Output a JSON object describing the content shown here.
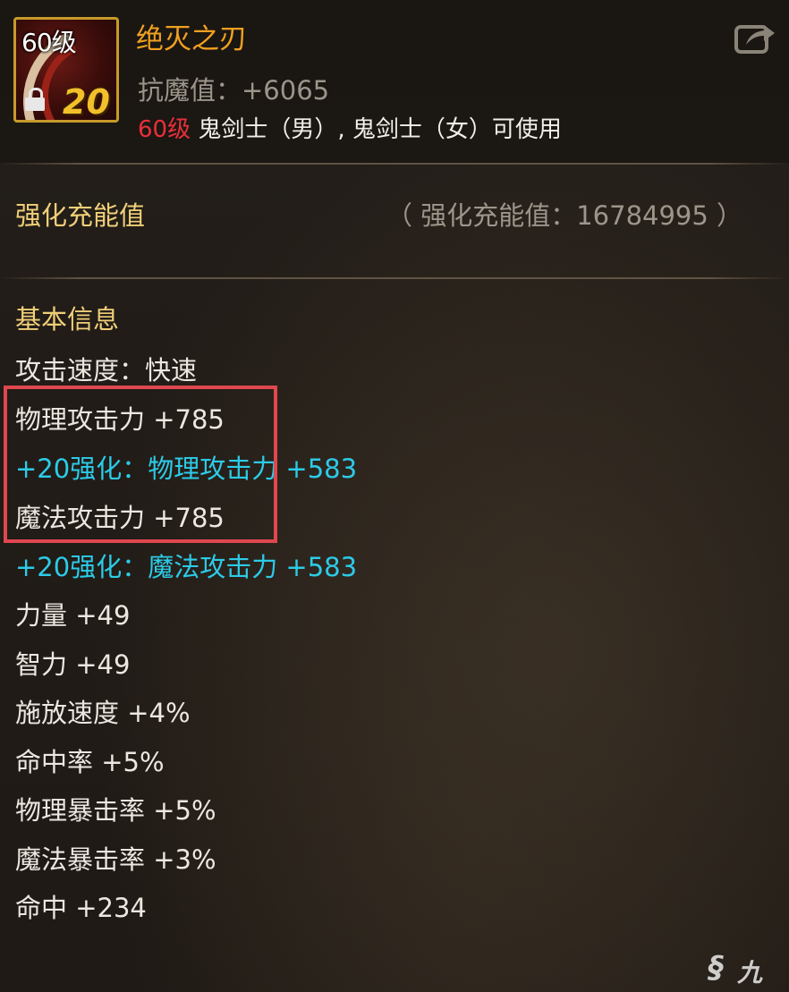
{
  "item": {
    "icon_level": "60级",
    "enhance_level": "20",
    "name": "绝灭之刃",
    "magic_resist": "抗魔值：+6065",
    "requirement_level": "60级",
    "requirement_classes": " 鬼剑士（男）, 鬼剑士（女）可使用"
  },
  "charge": {
    "title": "强化充能值",
    "value": "（ 强化充能值：16784995 ）"
  },
  "basic_info": {
    "title": "基本信息",
    "stats": [
      "攻击速度：快速",
      "物理攻击力 +785",
      "+20强化：物理攻击力 +583",
      "魔法攻击力 +785",
      "+20强化：魔法攻击力 +583",
      "力量 +49",
      "智力 +49",
      "施放速度 +4%",
      "命中率 +5%",
      "物理暴击率 +5%",
      "魔法暴击率 +3%",
      "命中 +234"
    ]
  },
  "watermark": "九游",
  "colors": {
    "item_name": "#f0a020",
    "section_title": "#f0cf78",
    "enhance_bonus": "#2ccbe8",
    "requirement_level": "#e8303a",
    "highlight_box": "#e0474f"
  },
  "icons": [
    "lock-icon",
    "share-icon",
    "jiuyou-logo-icon"
  ]
}
